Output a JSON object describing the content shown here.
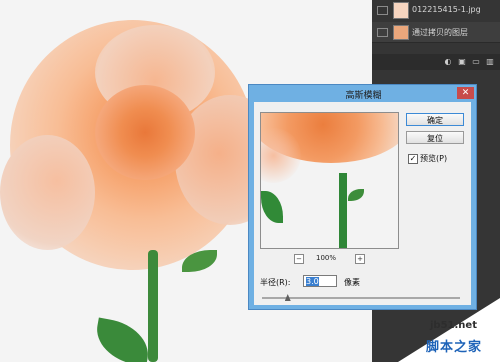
{
  "layers": {
    "items": [
      {
        "name": "012215415-1.jpg"
      },
      {
        "name": "通过拷贝的图层"
      }
    ]
  },
  "dialog": {
    "title": "高斯模糊",
    "close_glyph": "✕",
    "ok_label": "确定",
    "reset_label": "复位",
    "preview_check": "✓",
    "preview_label": "预览(P)",
    "zoom_minus": "−",
    "zoom_plus": "+",
    "zoom_value": "100%",
    "radius_label": "半径(R):",
    "radius_value": "3.0",
    "radius_unit": "像素",
    "radius_slider_fraction": 0.13
  },
  "watermark": {
    "url": "jb51.net",
    "name": "脚本之家"
  },
  "colors": {
    "dialog_frame": "#6fb0e3",
    "layers_panel": "#353535",
    "selection": "#3a7fd0"
  }
}
